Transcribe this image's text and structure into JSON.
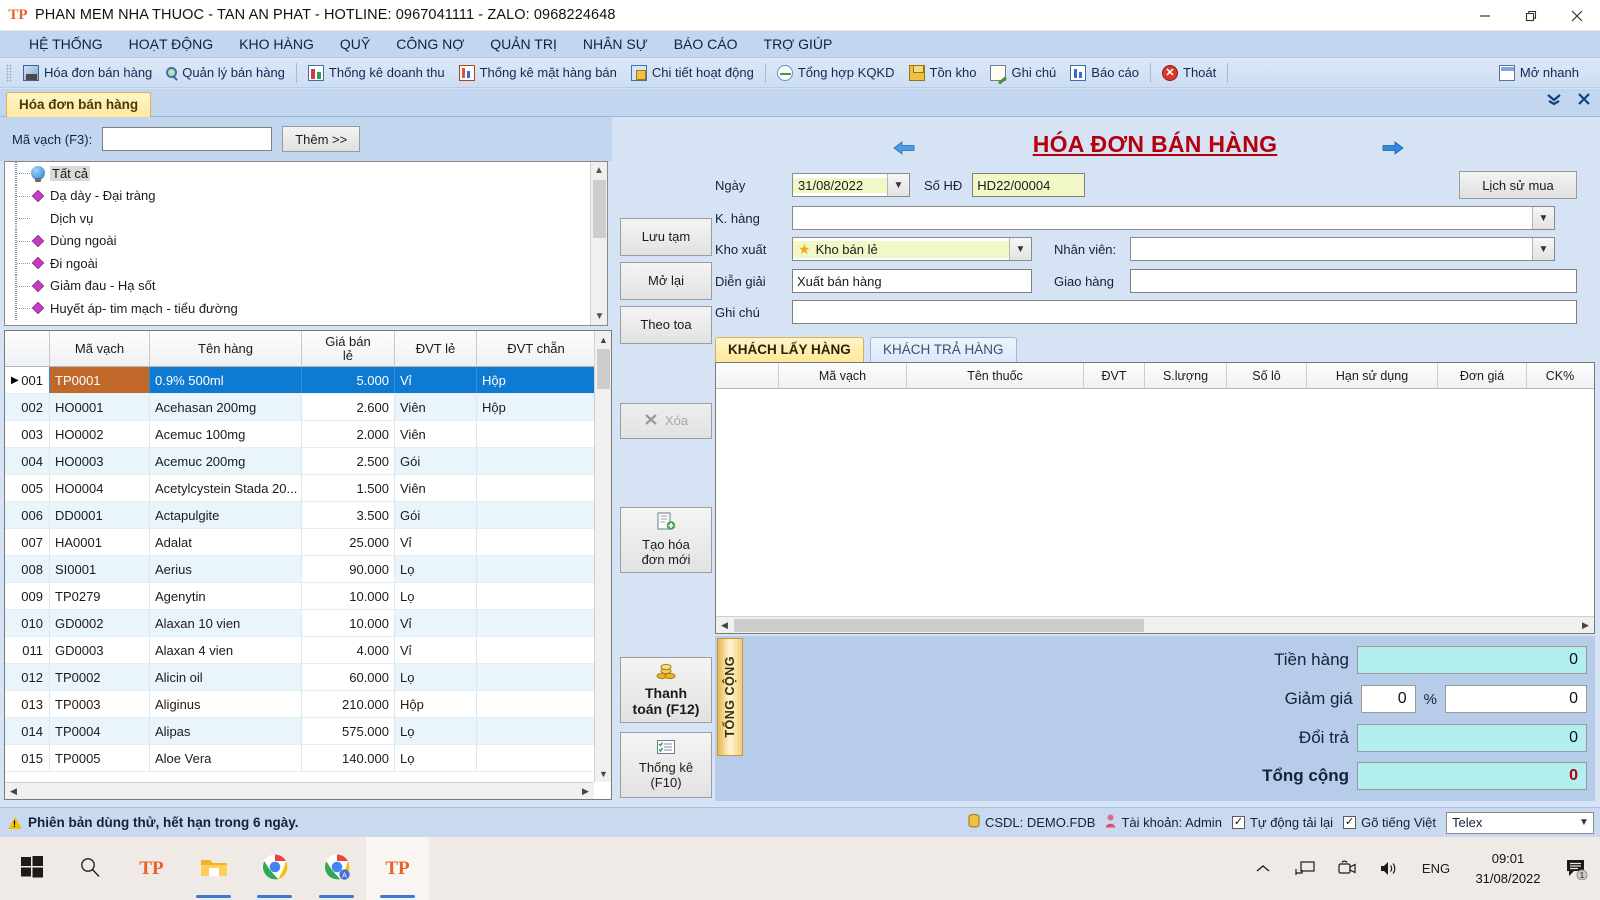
{
  "window": {
    "title": "PHAN MEM NHA THUOC - TAN AN PHAT - HOTLINE: 0967041111 - ZALO: 0968224648",
    "logo_text": "TP",
    "minimize": "–",
    "restore": "❐",
    "close": "✕"
  },
  "menu": {
    "items": [
      {
        "label": "HỆ THỐNG"
      },
      {
        "label": "HOẠT ĐỘNG"
      },
      {
        "label": "KHO HÀNG"
      },
      {
        "label": "QUỸ"
      },
      {
        "label": "CÔNG NỢ"
      },
      {
        "label": "QUẢN TRỊ"
      },
      {
        "label": "NHÂN SỰ"
      },
      {
        "label": "BÁO CÁO"
      },
      {
        "label": "TRỢ GIÚP"
      }
    ]
  },
  "toolbar": {
    "items": [
      {
        "label": "Hóa đơn bán hàng",
        "icon": "invoice-icon"
      },
      {
        "label": "Quản lý bán hàng",
        "icon": "magnifier-icon"
      },
      {
        "label": "Thống kê doanh thu",
        "icon": "revenue-chart-icon"
      },
      {
        "label": "Thống kê mặt hàng bán",
        "icon": "bar-chart-icon"
      },
      {
        "label": "Chi tiết hoạt động",
        "icon": "activity-detail-icon"
      },
      {
        "label": "Tổng hợp KQKD",
        "icon": "kqkd-icon"
      },
      {
        "label": "Tồn kho",
        "icon": "inventory-icon"
      },
      {
        "label": "Ghi chú",
        "icon": "note-icon"
      },
      {
        "label": "Báo cáo",
        "icon": "report-icon"
      },
      {
        "label": "Thoát",
        "icon": "exit-icon"
      }
    ],
    "quick_open": "Mở nhanh",
    "quick_open_icon": "quick-open-icon"
  },
  "doc_tab": {
    "label": "Hóa đơn bán hàng",
    "collapse_icon": "collapse-icon",
    "close_icon": "close-icon"
  },
  "barcode_bar": {
    "label": "Mã vạch (F3):",
    "value": "",
    "placeholder": "",
    "add_button": "Thêm >>"
  },
  "category_tree": {
    "items": [
      {
        "label": "Tất cả",
        "icon": "globe-icon",
        "selected": true
      },
      {
        "label": "Dạ dày - Đại tràng",
        "icon": "diamond-icon",
        "selected": false
      },
      {
        "label": "Dịch vụ",
        "icon": "none",
        "selected": false
      },
      {
        "label": "Dùng ngoài",
        "icon": "diamond-icon",
        "selected": false
      },
      {
        "label": "Đi ngoài",
        "icon": "diamond-icon",
        "selected": false
      },
      {
        "label": "Giảm đau - Hạ sốt",
        "icon": "diamond-icon",
        "selected": false
      },
      {
        "label": "Huyết áp- tim mạch - tiểu đường",
        "icon": "diamond-icon",
        "selected": false
      }
    ]
  },
  "product_grid": {
    "columns": [
      "",
      "Mã vạch",
      "Tên hàng",
      "Giá bán lẻ",
      "ĐVT lẻ",
      "ĐVT chẵn"
    ],
    "rows": [
      {
        "no": "001",
        "code": "TP0001",
        "name": "0.9% 500ml",
        "price": "5.000",
        "unit": "Vỉ",
        "pack": "Hộp",
        "selected": true
      },
      {
        "no": "002",
        "code": "HO0001",
        "name": "Acehasan 200mg",
        "price": "2.600",
        "unit": "Viên",
        "pack": "Hộp",
        "selected": false
      },
      {
        "no": "003",
        "code": "HO0002",
        "name": "Acemuc 100mg",
        "price": "2.000",
        "unit": "Viên",
        "pack": "",
        "selected": false
      },
      {
        "no": "004",
        "code": "HO0003",
        "name": "Acemuc 200mg",
        "price": "2.500",
        "unit": "Gói",
        "pack": "",
        "selected": false
      },
      {
        "no": "005",
        "code": "HO0004",
        "name": "Acetylcystein Stada 20...",
        "price": "1.500",
        "unit": "Viên",
        "pack": "",
        "selected": false
      },
      {
        "no": "006",
        "code": "DD0001",
        "name": "Actapulgite",
        "price": "3.500",
        "unit": "Gói",
        "pack": "",
        "selected": false
      },
      {
        "no": "007",
        "code": "HA0001",
        "name": "Adalat",
        "price": "25.000",
        "unit": "Vỉ",
        "pack": "",
        "selected": false
      },
      {
        "no": "008",
        "code": "SI0001",
        "name": "Aerius",
        "price": "90.000",
        "unit": "Lọ",
        "pack": "",
        "selected": false
      },
      {
        "no": "009",
        "code": "TP0279",
        "name": "Agenytin",
        "price": "10.000",
        "unit": "Lọ",
        "pack": "",
        "selected": false
      },
      {
        "no": "010",
        "code": "GD0002",
        "name": "Alaxan 10 vien",
        "price": "10.000",
        "unit": "Vỉ",
        "pack": "",
        "selected": false
      },
      {
        "no": "011",
        "code": "GD0003",
        "name": "Alaxan 4 vien",
        "price": "4.000",
        "unit": "Vỉ",
        "pack": "",
        "selected": false
      },
      {
        "no": "012",
        "code": "TP0002",
        "name": "Alicin oil",
        "price": "60.000",
        "unit": "Lọ",
        "pack": "",
        "selected": false
      },
      {
        "no": "013",
        "code": "TP0003",
        "name": "Aliginus",
        "price": "210.000",
        "unit": "Hộp",
        "pack": "",
        "selected": false
      },
      {
        "no": "014",
        "code": "TP0004",
        "name": "Alipas",
        "price": "575.000",
        "unit": "Lọ",
        "pack": "",
        "selected": false
      },
      {
        "no": "015",
        "code": "TP0005",
        "name": "Aloe Vera",
        "price": "140.000",
        "unit": "Lọ",
        "pack": "",
        "selected": false
      }
    ]
  },
  "side_buttons": [
    {
      "label": "Lưu tạm",
      "enabled": true,
      "icon": "none"
    },
    {
      "label": "Mở lại",
      "enabled": true,
      "icon": "none"
    },
    {
      "label": "Theo toa",
      "enabled": true,
      "icon": "none"
    },
    {
      "label": "Xóa",
      "enabled": false,
      "icon": "delete-x-icon"
    },
    {
      "label": "Tạo hóa\nđơn mới",
      "line1": "Tạo hóa",
      "line2": "đơn mới",
      "enabled": true,
      "icon": "new-invoice-icon"
    },
    {
      "label": "Thanh toán (F12)",
      "line1": "Thanh",
      "line2": "toán (F12)",
      "enabled": true,
      "icon": "coins-icon"
    },
    {
      "label": "Thống kê (F10)",
      "line1": "Thống kê",
      "line2": "(F10)",
      "enabled": true,
      "icon": "checklist-icon"
    }
  ],
  "invoice_form": {
    "title": "HÓA ĐƠN BÁN HÀNG",
    "prev_icon": "arrow-left-icon",
    "next_icon": "arrow-right-icon",
    "date_label": "Ngày",
    "date_value": "31/08/2022",
    "invoice_no_label": "Số HĐ",
    "invoice_no_value": "HD22/00004",
    "history_button": "Lịch sử mua",
    "customer_label": "K. hàng",
    "customer_value": "",
    "warehouse_label": "Kho xuất",
    "warehouse_value": "Kho bán lẻ",
    "warehouse_icon": "star-icon",
    "staff_label": "Nhân viên:",
    "staff_value": "",
    "description_label": "Diễn giải",
    "description_value": "Xuất bán hàng",
    "delivery_label": "Giao hàng",
    "delivery_value": "",
    "note_label": "Ghi chú",
    "note_value": ""
  },
  "detail_tabs": [
    {
      "label": "KHÁCH LẤY HÀNG",
      "active": true
    },
    {
      "label": "KHÁCH TRẢ HÀNG",
      "active": false
    }
  ],
  "detail_grid": {
    "columns": [
      "",
      "Mã vạch",
      "Tên thuốc",
      "ĐVT",
      "S.lượng",
      "Số lô",
      "Hạn sử dụng",
      "Đơn giá",
      "CK%"
    ],
    "rows": []
  },
  "totals": {
    "vertical_tab": "TỔNG CỘNG",
    "rows": [
      {
        "label": "Tiền hàng",
        "value": "0"
      },
      {
        "label": "Giảm giá",
        "percent": "0",
        "percent_symbol": "%",
        "value": "0"
      },
      {
        "label": "Đổi trả",
        "value": "0"
      },
      {
        "label": "Tổng cộng",
        "value": "0"
      }
    ]
  },
  "status_bar": {
    "trial_text": "Phiên bản dùng thử, hết hạn trong 6 ngày.",
    "warning_icon": "warning-icon",
    "db_label": "CSDL: DEMO.FDB",
    "db_icon": "database-icon",
    "account_label": "Tài khoản: Admin",
    "account_icon": "user-icon",
    "autoreload_label": "Tự động tải lại",
    "autoreload_checked": true,
    "vietnamese_label": "Gõ tiếng Việt",
    "vietnamese_checked": true,
    "input_method": "Telex"
  },
  "taskbar": {
    "items": [
      {
        "name": "start-button",
        "icon": "windows-icon"
      },
      {
        "name": "search-button",
        "icon": "search-icon"
      },
      {
        "name": "pharmacy-app-1",
        "icon": "tanantphat-icon"
      },
      {
        "name": "file-explorer",
        "icon": "folder-icon"
      },
      {
        "name": "chrome",
        "icon": "chrome-icon"
      },
      {
        "name": "chrome-profile",
        "icon": "chrome-profile-icon"
      },
      {
        "name": "pharmacy-app-active",
        "icon": "tanantphat-icon"
      }
    ],
    "tray": {
      "chevron": "chevron-up-icon",
      "network": "network-icon",
      "camera": "camera-icon",
      "volume": "volume-icon",
      "language": "ENG",
      "time": "09:01",
      "date": "31/08/2022",
      "notifications_count": "1"
    }
  }
}
